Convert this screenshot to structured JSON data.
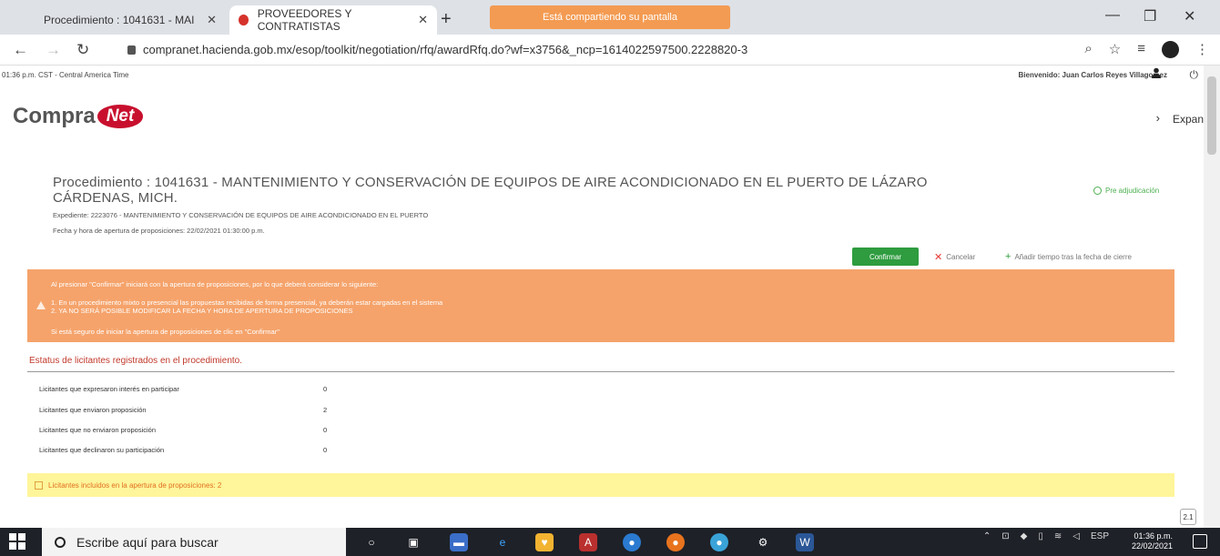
{
  "browser": {
    "tabs": [
      {
        "label": "Procedimiento : 1041631 - MAI"
      },
      {
        "label": "PROVEEDORES Y CONTRATISTAS"
      }
    ],
    "share_banner": "Está compartiendo su pantalla",
    "url": "compranet.hacienda.gob.mx/esop/toolkit/negotiation/rfq/awardRfq.do?wf=x3756&_ncp=1614022597500.2228820-3"
  },
  "header": {
    "timezone": "01:36 p.m. CST - Central America Time",
    "welcome": "Bienvenido: Juan Carlos Reyes Villagomez",
    "logo_text": "Compra",
    "logo_badge": "Net",
    "expand_label": "Expan"
  },
  "procedure": {
    "title_line1": "Procedimiento : 1041631 - MANTENIMIENTO Y CONSERVACIÓN DE EQUIPOS DE AIRE ACONDICIONADO EN EL PUERTO DE LÁZARO",
    "title_line2": "CÁRDENAS, MICH.",
    "expediente": "Expediente: 2223076 - MANTENIMIENTO Y CONSERVACIÓN DE EQUIPOS DE AIRE ACONDICIONADO EN EL PUERTO",
    "opening_date": "Fecha y hora de apertura de proposiciones: 22/02/2021 01:30:00 p.m.",
    "status": "Pre adjudicación"
  },
  "actions": {
    "confirm": "Confirmar",
    "cancel": "Cancelar",
    "add_time": "Añadir tiempo tras la fecha de cierre"
  },
  "warning": {
    "intro": "Al presionar \"Confirmar\" iniciará con la apertura de proposiciones, por lo que deberá considerar lo siguiente:",
    "item1": "1. En un procedimiento mixto o presencial las propuestas recibidas de forma presencial, ya deberán estar cargadas en el sistema",
    "item2": "2. YA NO SERÁ POSIBLE MODIFICAR LA FECHA Y HORA DE APERTURA DE PROPOSICIONES",
    "question": "Si está seguro de iniciar la apertura de proposiciones de clic en \"Confirmar\""
  },
  "bidders": {
    "section_title": "Estatus de licitantes registrados en el procedimiento.",
    "rows": [
      {
        "label": "Licitantes que expresaron interés en participar",
        "value": "0"
      },
      {
        "label": "Licitantes que enviaron proposición",
        "value": "2"
      },
      {
        "label": "Licitantes que no enviaron proposición",
        "value": "0"
      },
      {
        "label": "Licitantes que declinaron su participación",
        "value": "0"
      }
    ],
    "included": "Licitantes incluidos en la apertura de proposiciones: 2"
  },
  "zoom_badge": "2.1",
  "taskbar": {
    "search_placeholder": "Escribe aquí para buscar",
    "lang": "ESP",
    "time": "01:36 p.m.",
    "date": "22/02/2021"
  }
}
